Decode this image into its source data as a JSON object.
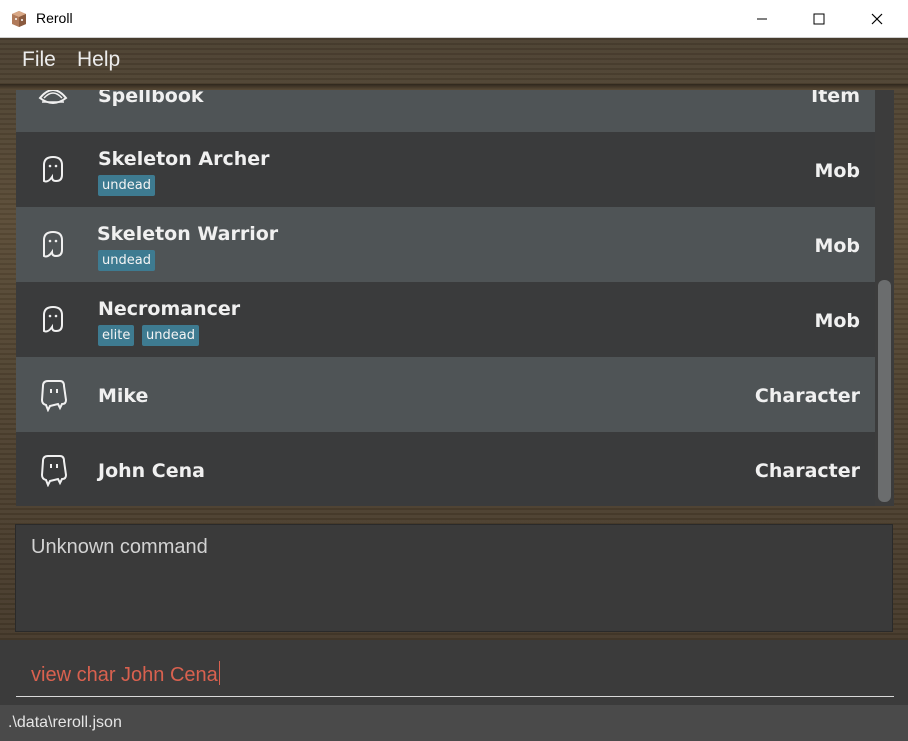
{
  "window": {
    "title": "Reroll"
  },
  "menu": {
    "file": "File",
    "help": "Help"
  },
  "list": {
    "items": [
      {
        "name": "Spellbook",
        "type": "Item",
        "tags": [],
        "icon": "spellbook-icon"
      },
      {
        "name": "Skeleton Archer",
        "type": "Mob",
        "tags": [
          "undead"
        ],
        "icon": "ghost-icon"
      },
      {
        "name": "Skeleton Warrior",
        "type": "Mob",
        "tags": [
          "undead"
        ],
        "icon": "ghost-icon"
      },
      {
        "name": "Necromancer",
        "type": "Mob",
        "tags": [
          "elite",
          "undead"
        ],
        "icon": "ghost-icon"
      },
      {
        "name": "Mike",
        "type": "Character",
        "tags": [],
        "icon": "character-icon"
      },
      {
        "name": "John Cena",
        "type": "Character",
        "tags": [],
        "icon": "character-icon"
      }
    ]
  },
  "result": {
    "text": "Unknown command"
  },
  "command": {
    "value": "view char John Cena"
  },
  "status": {
    "path": ".\\data\\reroll.json"
  },
  "colors": {
    "tag_bg": "#3e7b91",
    "command_text": "#d9614f",
    "row_light": "#4f5456",
    "row_dark": "#3a3b3c"
  }
}
